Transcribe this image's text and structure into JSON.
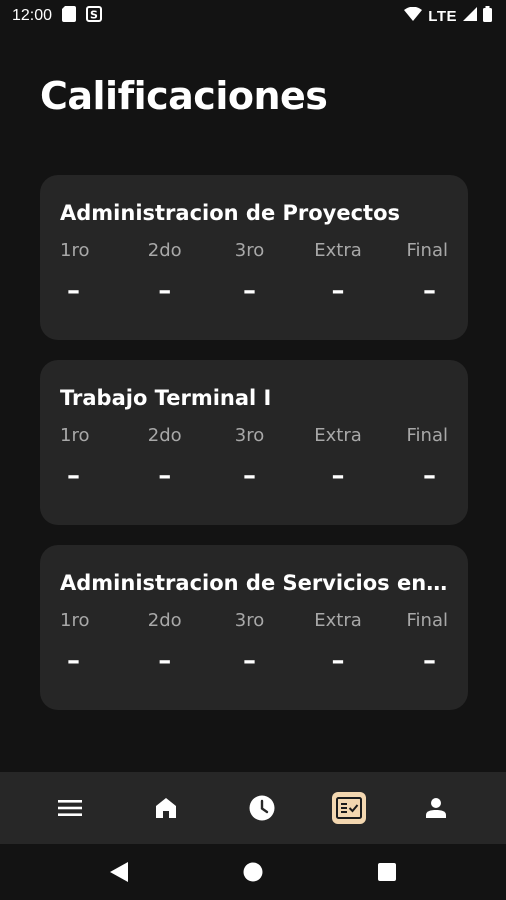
{
  "status_bar": {
    "time": "12:00",
    "network": "LTE"
  },
  "page": {
    "title": "Calificaciones"
  },
  "grade_labels": [
    "1ro",
    "2do",
    "3ro",
    "Extra",
    "Final"
  ],
  "courses": [
    {
      "name": "Administracion de Proyectos",
      "grades": [
        "–",
        "–",
        "–",
        "–",
        "–"
      ]
    },
    {
      "name": "Trabajo Terminal I",
      "grades": [
        "–",
        "–",
        "–",
        "–",
        "–"
      ]
    },
    {
      "name": "Administracion de Servicios en Red",
      "grades": [
        "–",
        "–",
        "–",
        "–",
        "–"
      ]
    }
  ],
  "bottom_nav": {
    "items": [
      {
        "icon": "menu-icon",
        "active": false
      },
      {
        "icon": "home-icon",
        "active": false
      },
      {
        "icon": "clock-icon",
        "active": false
      },
      {
        "icon": "grades-checklist-icon",
        "active": true
      },
      {
        "icon": "profile-icon",
        "active": false
      }
    ],
    "active_color": "#f3d7b0"
  },
  "colors": {
    "background": "#131313",
    "card": "#262626",
    "nav_bar": "#272727",
    "label_gray": "#a8a8a8"
  }
}
